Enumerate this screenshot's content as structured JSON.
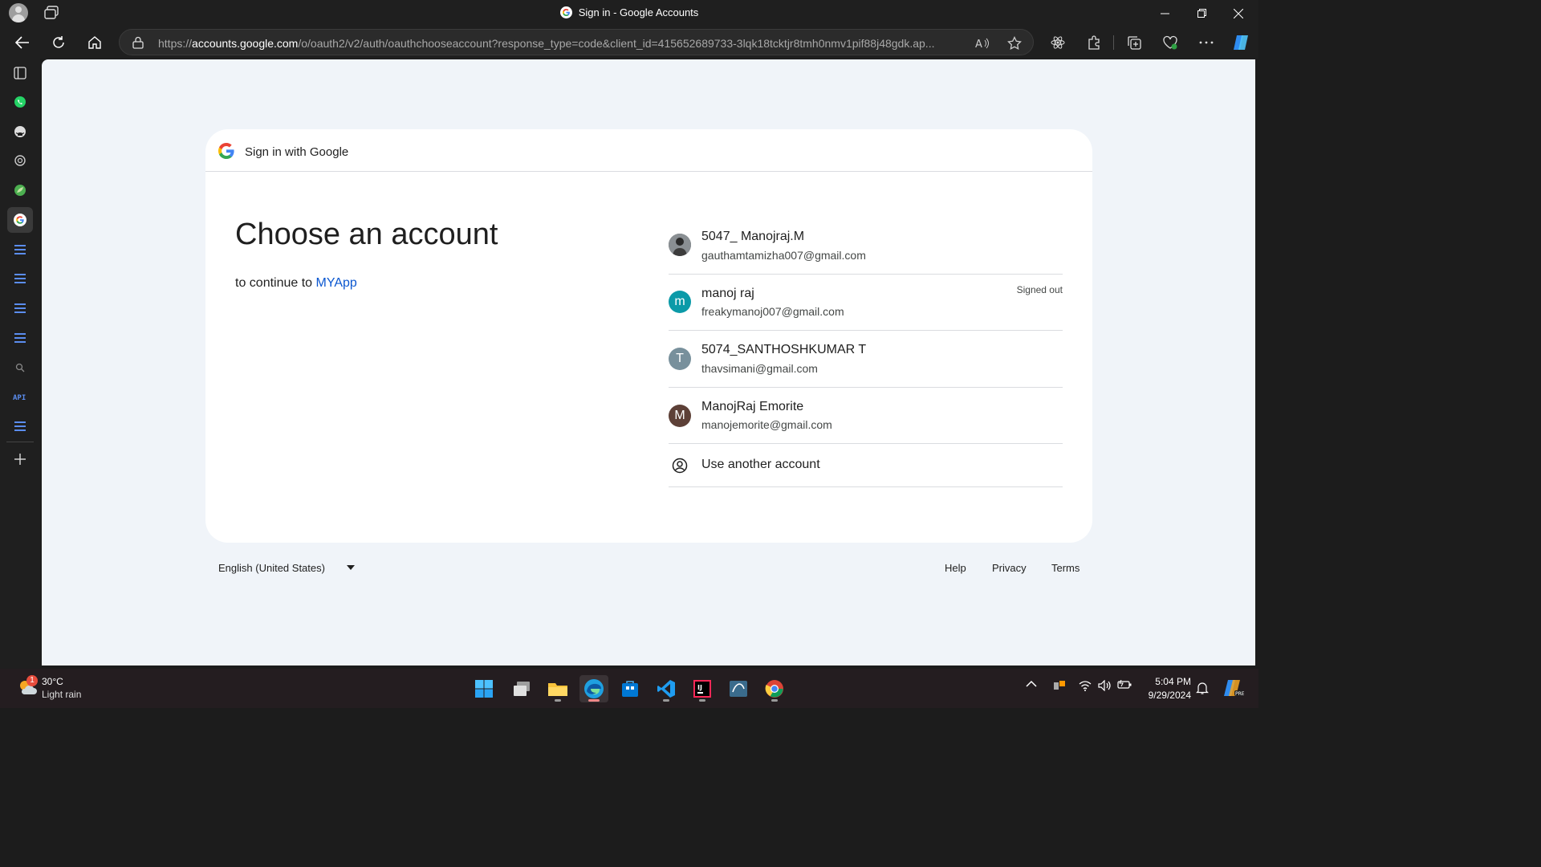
{
  "window": {
    "title": "Sign in - Google Accounts"
  },
  "address_bar": {
    "url_prefix": "https://",
    "url_domain": "accounts.google.com",
    "url_rest": "/o/oauth2/v2/auth/oauthchooseaccount?response_type=code&client_id=415652689733-3lqk18tcktjr8tmh0nmv1pif88j48gdk.ap..."
  },
  "card": {
    "header": "Sign in with Google",
    "heading": "Choose an account",
    "subtitle_prefix": "to continue to ",
    "app_name": "MYApp"
  },
  "accounts": [
    {
      "name": "5047_ Manojraj.M",
      "email": "gauthamtamizha007@gmail.com",
      "initial": "",
      "status": "",
      "color": "#5f6368"
    },
    {
      "name": "manoj raj",
      "email": "freakymanoj007@gmail.com",
      "initial": "m",
      "status": "Signed out",
      "color": "#0b9aa8"
    },
    {
      "name": "5074_SANTHOSHKUMAR T",
      "email": "thavsimani@gmail.com",
      "initial": "T",
      "status": "",
      "color": "#78909c"
    },
    {
      "name": "ManojRaj Emorite",
      "email": "manojemorite@gmail.com",
      "initial": "M",
      "status": "",
      "color": "#5d4037"
    }
  ],
  "use_another": "Use another account",
  "footer": {
    "language": "English (United States)",
    "help": "Help",
    "privacy": "Privacy",
    "terms": "Terms"
  },
  "taskbar": {
    "weather_temp": "30°C",
    "weather_desc": "Light rain",
    "weather_badge": "1",
    "time": "5:04 PM",
    "date": "9/29/2024"
  },
  "sidebar_items": [
    "tabs-icon",
    "whatsapp-icon",
    "github-icon",
    "chatgpt-icon",
    "leaf-icon",
    "google-icon",
    "api-doc-icon",
    "api-doc-icon",
    "api-doc-icon",
    "api-doc-icon",
    "search-icon",
    "api-icon",
    "api-doc-icon",
    "add-icon"
  ],
  "colors": {
    "accent": "#0b57d0",
    "page_bg": "#f0f4f9",
    "chrome_bg": "#1f1f1f"
  }
}
